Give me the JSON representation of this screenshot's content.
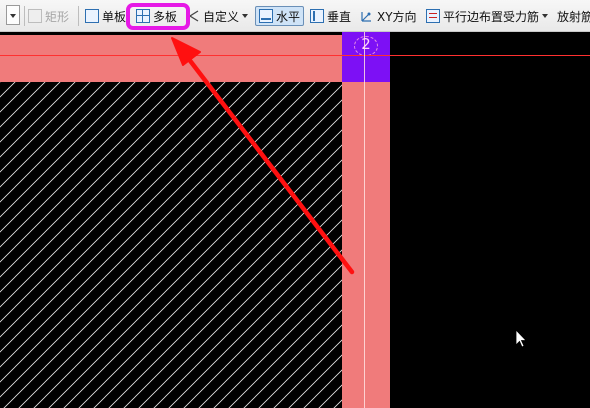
{
  "toolbar": {
    "rectangle_label": "矩形",
    "single_slab_label": "单板",
    "multi_slab_label": "多板",
    "custom_label": "自定义",
    "horizontal_label": "水平",
    "vertical_label": "垂直",
    "xy_direction_label": "XY方向",
    "parallel_edge_label": "平行边布置受力筋",
    "radial_label": "放射筋"
  },
  "canvas": {
    "column_label": "2",
    "colors": {
      "beam": "#f07b7b",
      "column": "#7d10f5",
      "highlight": "#e619e6",
      "arrow": "#ff1010",
      "background": "#000000"
    }
  }
}
